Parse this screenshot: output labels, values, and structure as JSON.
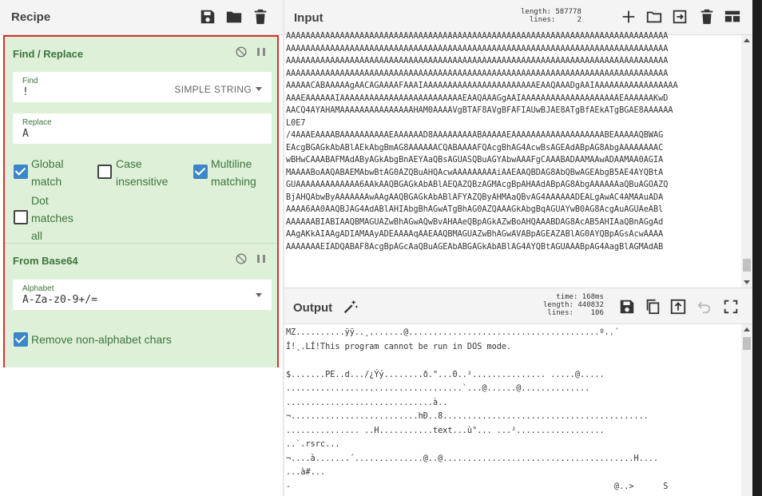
{
  "recipe": {
    "title": "Recipe",
    "header_icons": [
      "save-icon",
      "folder-icon",
      "trash-icon"
    ],
    "operations": [
      {
        "name": "Find / Replace",
        "find": {
          "label": "Find",
          "value": "!",
          "mode": "SIMPLE STRING"
        },
        "replace": {
          "label": "Replace",
          "value": "A"
        },
        "options": {
          "global_match": {
            "label_1": "Global",
            "label_2": "match",
            "checked": true
          },
          "case_insensitive": {
            "label_1": "Case",
            "label_2": "insensitive",
            "checked": false
          },
          "multiline": {
            "label_1": "Multiline",
            "label_2": "matching",
            "checked": true
          },
          "dot_matches_all": {
            "label_1": "Dot",
            "label_2": "matches",
            "label_3": "all",
            "checked": false
          }
        }
      },
      {
        "name": "From Base64",
        "alphabet": {
          "label": "Alphabet",
          "value": "A-Za-z0-9+/="
        },
        "remove_non_alphabet": {
          "label": "Remove non-alphabet chars",
          "checked": true
        }
      }
    ]
  },
  "input": {
    "title": "Input",
    "stats": {
      "length_label": "length:",
      "length": "587778",
      "lines_label": "lines:",
      "lines": "2"
    },
    "lines": [
      "AAAAAAAAAAAAAAAAAAAAAAAAAAAAAAAAAAAAAAAAAAAAAAAAAAAAAAAAAAAAAAAAAAAAAAAAAAAAAA",
      "AAAAAAAAAAAAAAAAAAAAAAAAAAAAAAAAAAAAAAAAAAAAAAAAAAAAAAAAAAAAAAAAAAAAAAAAAAAAAA",
      "AAAAAAAAAAAAAAAAAAAAAAAAAAAAAAAAAAAAAAAAAAAAAAAAAAAAAAAAAAAAAAAAAAAAAAAAAAAAAA",
      "AAAAAAAAAAAAAAAAAAAAAAAAAAAAAAAAAAAAAAAAAAAAAAAAAAAAAAAAAAAAAAAAAAAAAAAAAAAAAA",
      "AAAAACABAAAAAgAACAGAAAAFAAAIAAAAAAAAAAAAAAAAAAAAAAAEAAQAAADgAAIAAAAAAAAAAAAAAAAA",
      "AAAEAAAAAAIAAAAAAAAAAAAAAAAAAAAAAAAAEAAQAAAGgAAIAAAAAAAAAAAAAAAAAAAAEAAAAAAKwD",
      "AACQ4AYAHAMAAAAAAAAAAAAAAAHAM0AAAAVgBTAF8AVgBFAFIAUwBJAE8ATgBfAEkATgBGAE8AAAAAA",
      "L0E7",
      "/4AAAEAAAABAAAAAAAAAAEAAAAAAD8AAAAAAAAABAAAAAEAAAAAAAAAAAAAAAAAAABEAAAAAQBWAG",
      "EAcgBGAGkAbABlAEkAbgBmAG8AAAAAACQABAAAAFQAcgBhAG4AcwBsAGEAdABpAG8AbgAAAAAAAAC",
      "wBHwCAAABAFMAdAByAGkAbgBnAEYAaQBsAGUASQBuAGYAbwAAAFgCAAABADAAMAAwADAAMAA0AGIA",
      "MAAAABoAAQABAEMAbwBtAG0AZQBuAHQAcwAAAAAAAAAiAAEAAQBDAG8AbQBwAGEAbgB5AE4AYQBtA",
      "GUAAAAAAAAAAAAA6AAkAAQBGAGkAbABlAEQAZQBzAGMAcgBpAHAAdABpAG8AbgAAAAAAaQBuAGOAZQ",
      "BjAHQAbwByAAAAAAAwAAgAAQBGAGkAbABlAFYAZQByAHMAaQBvAG4AAAAAADEALgAwAC4AMAAuADA",
      "AAAA6AA0AAQBJAG4AdABlAHIAbgBhAGwATgBhAG0AZQAAAGkAbgBqAGUAYwB0AG8AcgAuAGUAeABl",
      "AAAAAABIABIAAQBMAGUAZwBhAGwAQwBvAHAAeQBpAGkAZwBoAHQAAABDAG8AcAB5AHIAaQBnAGgAd",
      "AAgAKkAIAAgADIAMAAyADEAAAAqAAEAAQBMAGUAZwBhAGwAVABpAGEAZABlAG0AYQBpAGsAcwAAAA",
      "AAAAAAAEIADQABAF8AcgBpAGcAaQBuAGEAbABGAGkAbABlAG4AYQBtAGUAAABpAG4AagBlAGMAdAB"
    ]
  },
  "output": {
    "title": "Output",
    "stats": {
      "time_label": "time:",
      "time": "168ms",
      "length_label": "length:",
      "length": "440832",
      "lines_label": "lines:",
      "lines": "106"
    },
    "lines": [
      "MZ..........ÿÿ..¸.......@.......................................º..´",
      "Í!¸.LÍ!This program cannot be run in DOS mode.",
      "",
      "$.......PE..d.../¿Ýý........ð.\"...0..²............... .....@.....",
      "....................................`...@......@..............",
      "..............................à..",
      "¬..........................hÐ..8..........................................",
      "............... ..H...........text...ù°... ...²..................",
      "..`.rsrc...",
      "¬....à.......´..............@..@.......................................H....",
      "...à#...",
      "-                                                                  @..>      S"
    ]
  }
}
